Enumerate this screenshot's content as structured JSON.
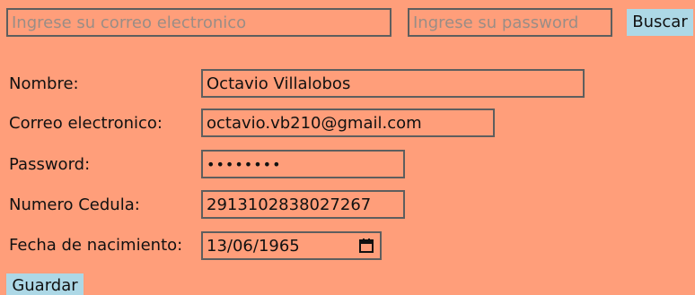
{
  "search": {
    "email_placeholder": "Ingrese su correo electronico",
    "password_placeholder": "Ingrese su password",
    "buscar_label": "Buscar"
  },
  "form": {
    "nombre_label": "Nombre:",
    "nombre_value": "Octavio Villalobos",
    "correo_label": "Correo electronico:",
    "correo_value": "octavio.vb210@gmail.com",
    "password_label": "Password:",
    "password_value": "••••••••",
    "cedula_label": "Numero Cedula:",
    "cedula_value": "2913102838027267",
    "fecha_label": "Fecha de nacimiento:",
    "fecha_value": "13/06/1965",
    "calendar_icon": "calendar-icon",
    "guardar_label": "Guardar"
  },
  "colors": {
    "background": "#ff9e7a",
    "button": "#add8e6"
  }
}
